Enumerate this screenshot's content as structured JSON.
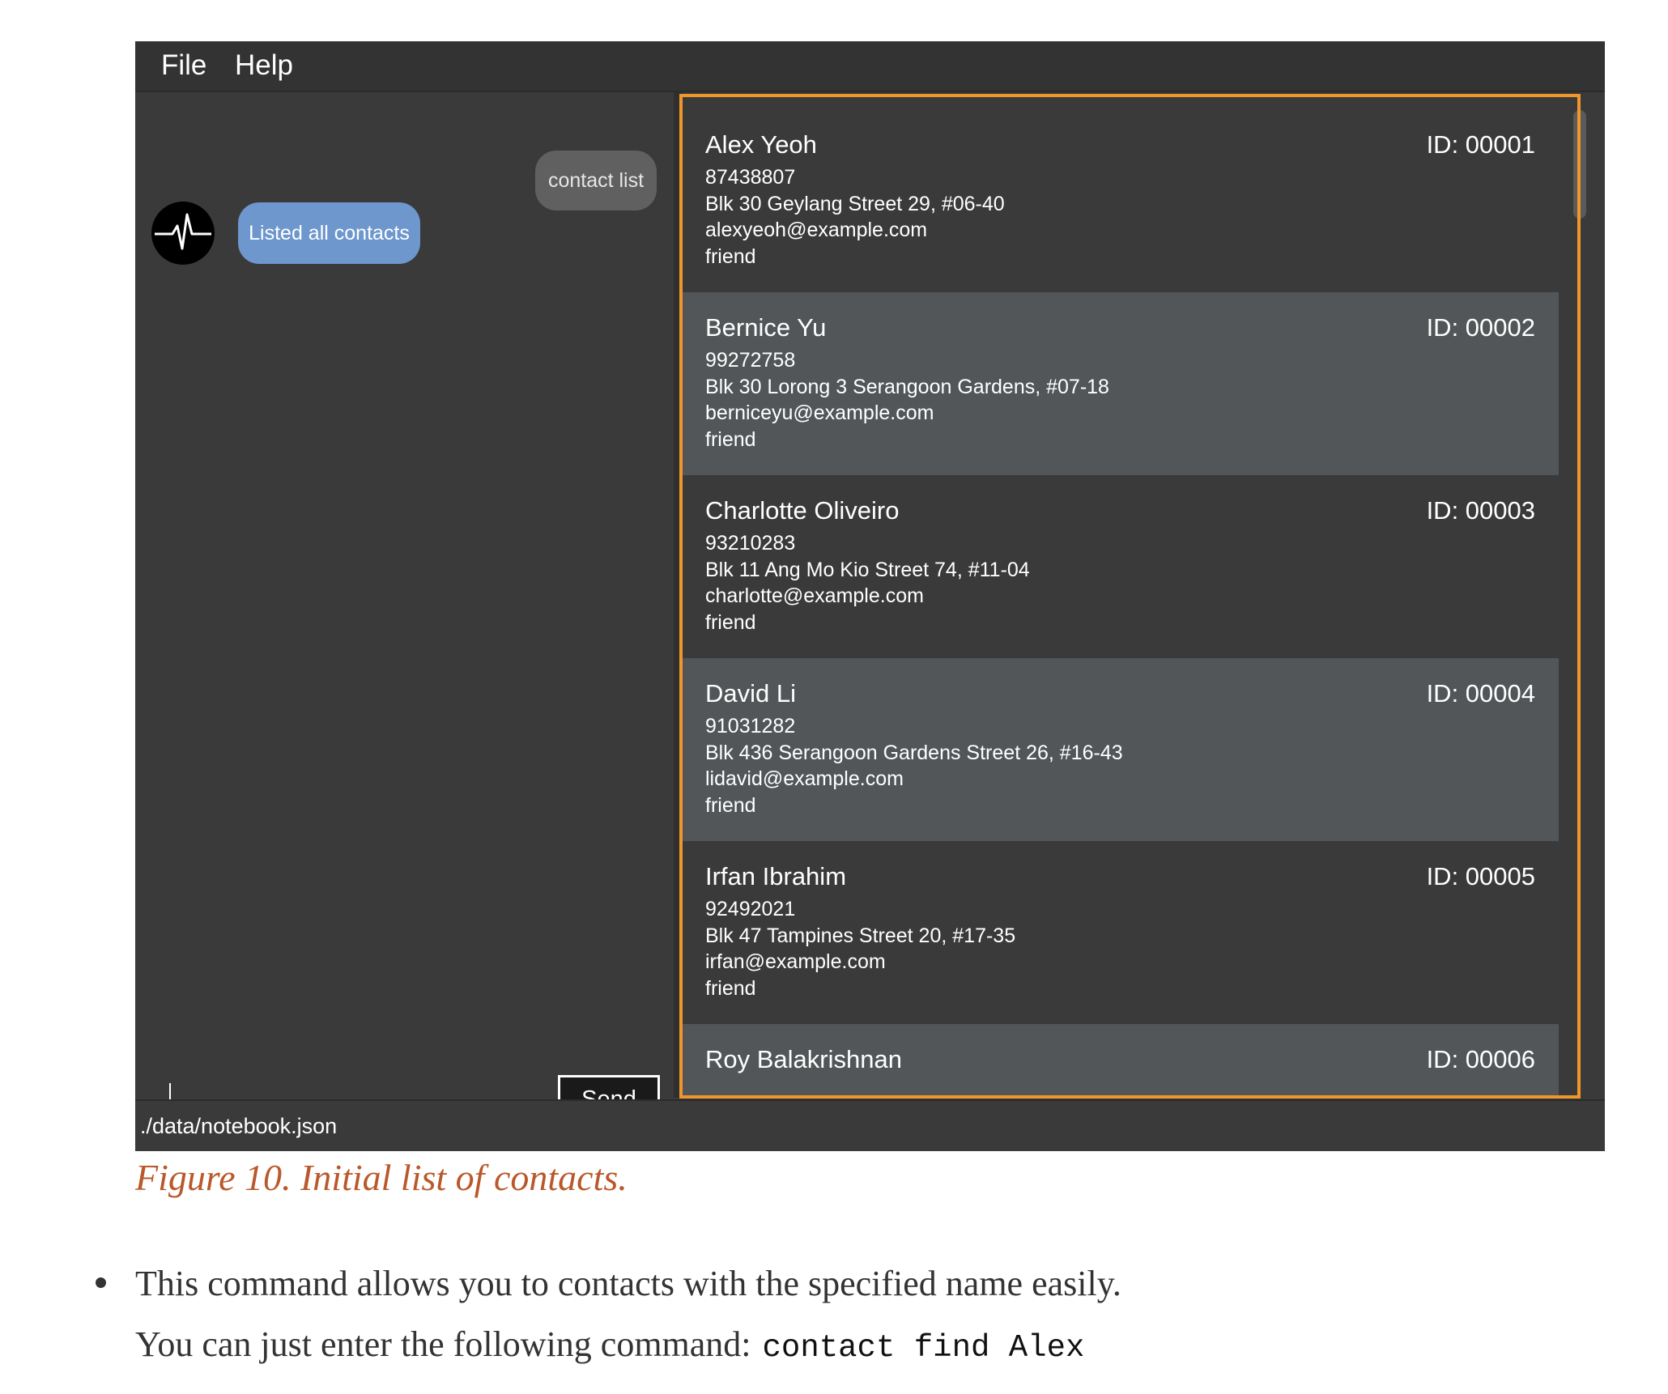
{
  "menubar": {
    "file_label": "File",
    "help_label": "Help"
  },
  "chat": {
    "user_message": "contact list",
    "bot_message": "Listed all contacts",
    "input_value": "",
    "send_label": "Send"
  },
  "contacts": [
    {
      "name": "Alex Yeoh",
      "id": "ID: 00001",
      "phone": "87438807",
      "address": "Blk 30 Geylang Street 29, #06-40",
      "email": "alexyeoh@example.com",
      "tag": "friend"
    },
    {
      "name": "Bernice Yu",
      "id": "ID: 00002",
      "phone": "99272758",
      "address": "Blk 30 Lorong 3 Serangoon Gardens, #07-18",
      "email": "berniceyu@example.com",
      "tag": "friend"
    },
    {
      "name": "Charlotte Oliveiro",
      "id": "ID: 00003",
      "phone": "93210283",
      "address": "Blk 11 Ang Mo Kio Street 74, #11-04",
      "email": "charlotte@example.com",
      "tag": "friend"
    },
    {
      "name": "David Li",
      "id": "ID: 00004",
      "phone": "91031282",
      "address": "Blk 436 Serangoon Gardens Street 26, #16-43",
      "email": "lidavid@example.com",
      "tag": "friend"
    },
    {
      "name": "Irfan Ibrahim",
      "id": "ID: 00005",
      "phone": "92492021",
      "address": "Blk 47 Tampines Street 20, #17-35",
      "email": "irfan@example.com",
      "tag": "friend"
    },
    {
      "name": "Roy Balakrishnan",
      "id": "ID: 00006"
    }
  ],
  "status_bar": {
    "file_path": "./data/notebook.json"
  },
  "document": {
    "caption": "Figure 10. Initial list of contacts.",
    "bullet_text": "This command allows you to contacts with the specified name easily.",
    "instruction_text": "You can just enter the following command:",
    "command": "contact find Alex"
  },
  "colors": {
    "highlight_border": "#f0962b",
    "user_bubble": "#606060",
    "bot_bubble": "#6d97cd",
    "caption": "#b9582a"
  },
  "icons": {
    "avatar": "heartbeat-icon"
  }
}
